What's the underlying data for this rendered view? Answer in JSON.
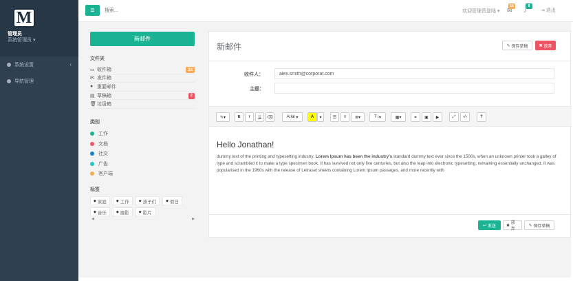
{
  "sidebar": {
    "logo_letter": "M",
    "user_name": "管理员",
    "user_role": "系统管理员",
    "menu": [
      {
        "label": "系统设置",
        "icon": "gear-icon"
      },
      {
        "label": "导航管理",
        "icon": "link-icon"
      }
    ]
  },
  "topbar": {
    "search_placeholder": "搜索...",
    "welcome": "欢迎管理员登陆",
    "mail_count": "16",
    "bell_count": "8",
    "logout": "退出"
  },
  "left": {
    "compose": "新邮件",
    "folders_title": "文件夹",
    "folders": [
      {
        "label": "收件箱",
        "icon": "inbox-icon",
        "badge": "16",
        "badge_color": "#f8ac59"
      },
      {
        "label": "发件箱",
        "icon": "envelope-icon",
        "badge": "",
        "badge_color": ""
      },
      {
        "label": "重要邮件",
        "icon": "certificate-icon",
        "badge": "",
        "badge_color": ""
      },
      {
        "label": "草稿箱",
        "icon": "file-icon",
        "badge": "2",
        "badge_color": "#ed5565"
      },
      {
        "label": "垃圾箱",
        "icon": "trash-icon",
        "badge": "",
        "badge_color": ""
      }
    ],
    "categories_title": "类别",
    "categories": [
      {
        "label": "工作",
        "color": "#1ab394"
      },
      {
        "label": "文档",
        "color": "#ed5565"
      },
      {
        "label": "社交",
        "color": "#1c84c6"
      },
      {
        "label": "广告",
        "color": "#23c6c8"
      },
      {
        "label": "客户端",
        "color": "#f8ac59"
      }
    ],
    "tags_title": "标签",
    "tags": [
      "家庭",
      "工作",
      "孩子们",
      "假日",
      "音乐",
      "摄影",
      "影片"
    ]
  },
  "mail": {
    "title": "新邮件",
    "save_draft": "保存草稿",
    "discard": "放弃",
    "to_label": "收件人：",
    "to_value": "alex.smith@corporat.com",
    "subject_label": "主题：",
    "subject_value": "",
    "font_name": "Arial",
    "greeting": "Hello Jonathan!",
    "body_before": "dummy text of the printing and typesetting industry. ",
    "body_bold": "Lorem Ipsum has been the industry's",
    "body_after": " standard dummy text ever since the 1500s, when an unknown printer took a galley of type and scrambled it to make a type specimen book. It has survived not only five centuries, but also the leap into electronic typesetting, remaining essentially unchanged. It was popularised in the 1960s with the release of Letraset sheets containing Lorem Ipsum passages, and more recently with",
    "send": "发送",
    "discard_bottom": "放弃",
    "save_draft_bottom": "保存草稿"
  }
}
